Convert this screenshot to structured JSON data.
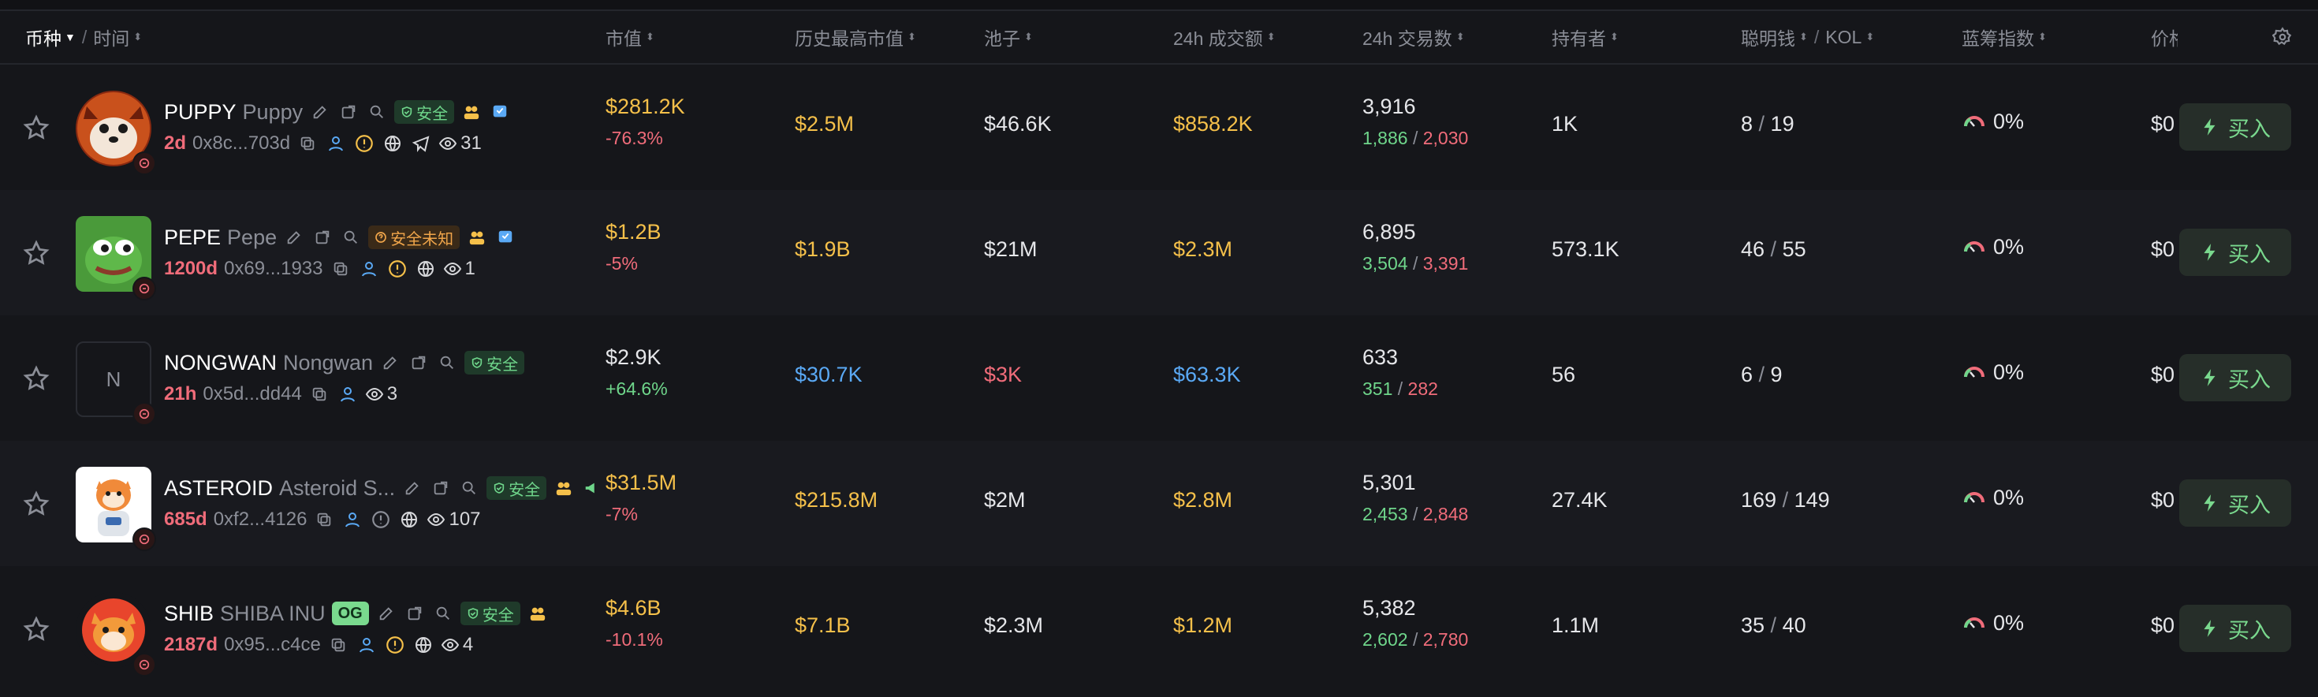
{
  "header": {
    "col_coin": "币种",
    "col_time": "时间",
    "col_mcap": "市值",
    "col_ath": "历史最高市值",
    "col_pool": "池子",
    "col_vol": "24h 成交额",
    "col_txs": "24h 交易数",
    "col_holders": "持有者",
    "col_smart": "聪明钱",
    "col_kol": "KOL",
    "col_bluechip": "蓝筹指数",
    "col_price": "价格"
  },
  "rows": [
    {
      "symbol": "PUPPY",
      "name": "Puppy",
      "tag": "安全",
      "tag_type": "safe",
      "age": "2d",
      "address": "0x8c...703d",
      "views": "31",
      "mcap": "$281.2K",
      "mcap_color": "#f5c04a",
      "mcap_change": "-76.3%",
      "ath": "$2.5M",
      "ath_color": "#f5c04a",
      "pool": "$46.6K",
      "pool_color": "#e6e7ea",
      "vol": "$858.2K",
      "vol_color": "#f5c04a",
      "txs": "3,916",
      "buys": "1,886",
      "sells": "2,030",
      "holders": "1K",
      "smart": "8",
      "kol": "19",
      "bluechip": "0%",
      "price": "$0",
      "buy_label": "买入"
    },
    {
      "symbol": "PEPE",
      "name": "Pepe",
      "tag": "安全未知",
      "tag_type": "warn",
      "age": "1200d",
      "address": "0x69...1933",
      "views": "1",
      "mcap": "$1.2B",
      "mcap_color": "#f5c04a",
      "mcap_change": "-5%",
      "ath": "$1.9B",
      "ath_color": "#f5c04a",
      "pool": "$21M",
      "pool_color": "#e6e7ea",
      "vol": "$2.3M",
      "vol_color": "#f5c04a",
      "txs": "6,895",
      "buys": "3,504",
      "sells": "3,391",
      "holders": "573.1K",
      "smart": "46",
      "kol": "55",
      "bluechip": "0%",
      "price": "$0",
      "buy_label": "买入"
    },
    {
      "symbol": "NONGWAN",
      "name": "Nongwan",
      "tag": "安全",
      "tag_type": "safe",
      "age": "21h",
      "address": "0x5d...dd44",
      "views": "3",
      "mcap": "$2.9K",
      "mcap_color": "#e6e7ea",
      "mcap_change": "+64.6%",
      "ath": "$30.7K",
      "ath_color": "#5aa9f5",
      "pool": "$3K",
      "pool_color": "#f06c7a",
      "vol": "$63.3K",
      "vol_color": "#5aa9f5",
      "txs": "633",
      "buys": "351",
      "sells": "282",
      "holders": "56",
      "smart": "6",
      "kol": "9",
      "bluechip": "0%",
      "price": "$0",
      "buy_label": "买入",
      "avatar_letter": "N"
    },
    {
      "symbol": "ASTEROID",
      "name": "Asteroid S...",
      "tag": "安全",
      "tag_type": "safe",
      "age": "685d",
      "address": "0xf2...4126",
      "views": "107",
      "mcap": "$31.5M",
      "mcap_color": "#f5c04a",
      "mcap_change": "-7%",
      "ath": "$215.8M",
      "ath_color": "#f5c04a",
      "pool": "$2M",
      "pool_color": "#e6e7ea",
      "vol": "$2.8M",
      "vol_color": "#f5c04a",
      "txs": "5,301",
      "buys": "2,453",
      "sells": "2,848",
      "holders": "27.4K",
      "smart": "169",
      "kol": "149",
      "bluechip": "0%",
      "price": "$0",
      "buy_label": "买入"
    },
    {
      "symbol": "SHIB",
      "name": "SHIBA INU",
      "og": "OG",
      "tag": "安全",
      "tag_type": "safe",
      "age": "2187d",
      "address": "0x95...c4ce",
      "views": "4",
      "mcap": "$4.6B",
      "mcap_color": "#f5c04a",
      "mcap_change": "-10.1%",
      "ath": "$7.1B",
      "ath_color": "#f5c04a",
      "pool": "$2.3M",
      "pool_color": "#e6e7ea",
      "vol": "$1.2M",
      "vol_color": "#f5c04a",
      "txs": "5,382",
      "buys": "2,602",
      "sells": "2,780",
      "holders": "1.1M",
      "smart": "35",
      "kol": "40",
      "bluechip": "0%",
      "price": "$0",
      "buy_label": "买入"
    }
  ]
}
